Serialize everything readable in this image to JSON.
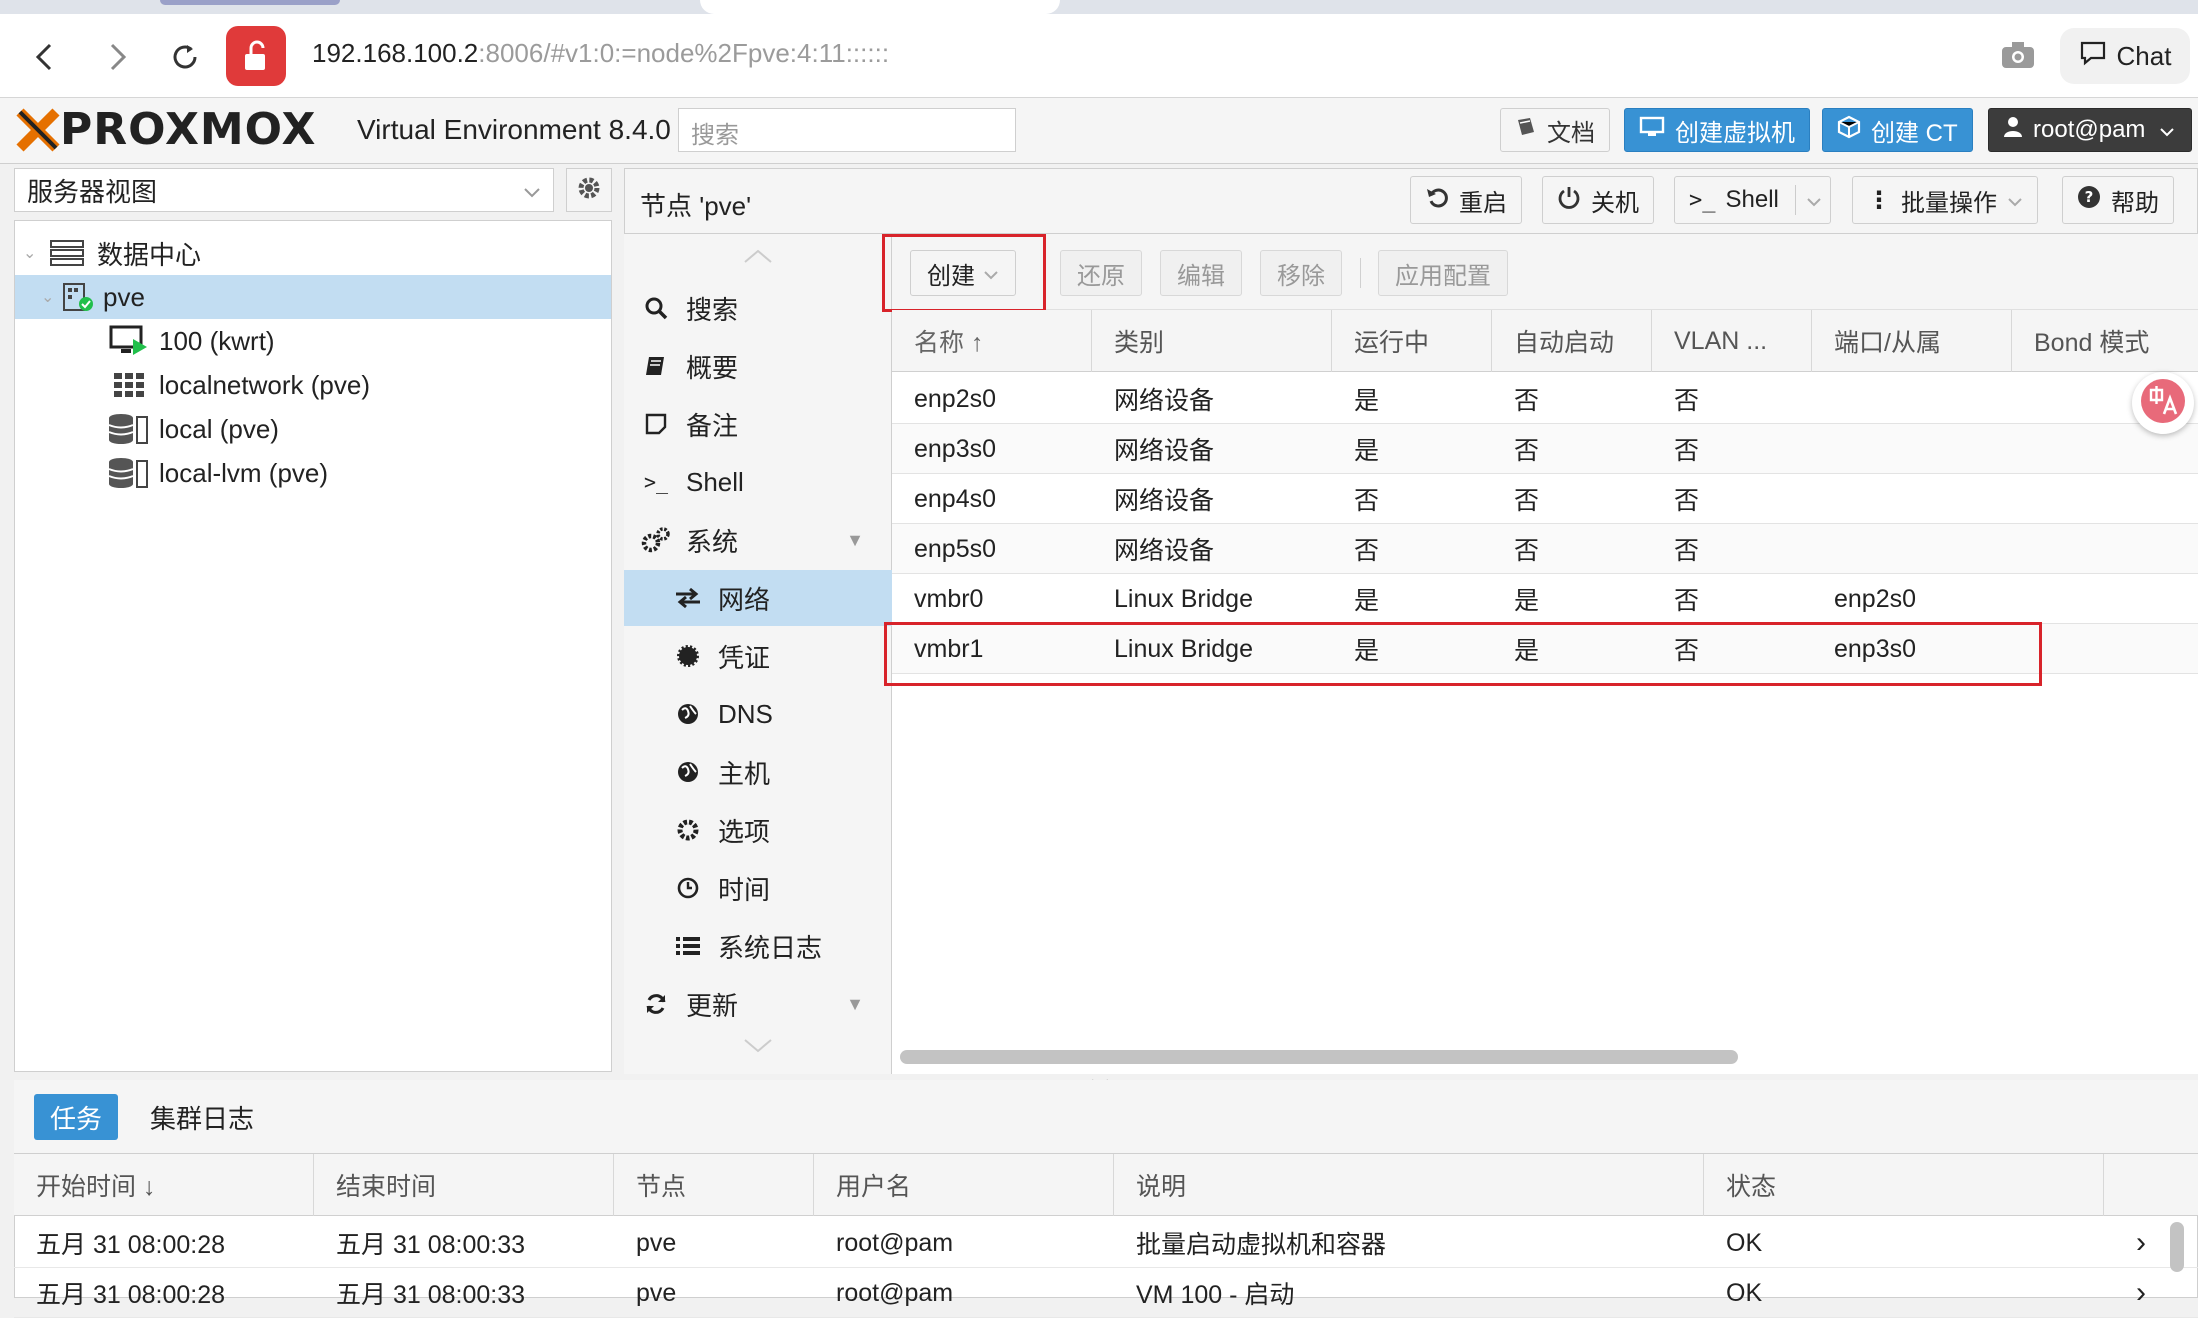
{
  "browser": {
    "url_host": "192.168.100.2",
    "url_rest": ":8006/#v1:0:=node%2Fpve:4:11::::::",
    "chat_label": "Chat",
    "icons": [
      "back-icon",
      "forward-icon",
      "reload-icon",
      "unlock-icon",
      "camera-icon",
      "chat-icon"
    ]
  },
  "header": {
    "logo_text": "PROXMOX",
    "product": "Virtual Environment 8.4.0",
    "search_placeholder": "搜索",
    "docs_label": "文档",
    "create_vm_label": "创建虚拟机",
    "create_ct_label": "创建 CT",
    "user_label": "root@pam"
  },
  "tree": {
    "view_label": "服务器视图",
    "items": [
      {
        "label": "数据中心",
        "icon": "datacenter-icon"
      },
      {
        "label": "pve",
        "icon": "node-icon",
        "selected": true
      },
      {
        "label": "100 (kwrt)",
        "icon": "vm-running-icon"
      },
      {
        "label": "localnetwork (pve)",
        "icon": "sdn-grid-icon"
      },
      {
        "label": "local (pve)",
        "icon": "storage-icon"
      },
      {
        "label": "local-lvm (pve)",
        "icon": "storage-icon"
      }
    ]
  },
  "node": {
    "title": "节点 'pve'",
    "restart_label": "重启",
    "shutdown_label": "关机",
    "shell_label": "Shell",
    "bulk_label": "批量操作",
    "help_label": "帮助"
  },
  "menu": {
    "items": [
      {
        "label": "搜索",
        "icon": "search-icon"
      },
      {
        "label": "概要",
        "icon": "book-icon"
      },
      {
        "label": "备注",
        "icon": "note-icon"
      },
      {
        "label": "Shell",
        "icon": "terminal-icon"
      },
      {
        "label": "系统",
        "icon": "cogs-icon"
      },
      {
        "label": "网络",
        "icon": "exchange-icon",
        "selected": true
      },
      {
        "label": "凭证",
        "icon": "certificate-icon"
      },
      {
        "label": "DNS",
        "icon": "globe-icon"
      },
      {
        "label": "主机",
        "icon": "globe-icon"
      },
      {
        "label": "选项",
        "icon": "gear-icon"
      },
      {
        "label": "时间",
        "icon": "clock-icon"
      },
      {
        "label": "系统日志",
        "icon": "list-icon"
      },
      {
        "label": "更新",
        "icon": "refresh-icon"
      }
    ]
  },
  "network": {
    "toolbar": {
      "create": "创建",
      "revert": "还原",
      "edit": "编辑",
      "remove": "移除",
      "apply": "应用配置"
    },
    "columns": [
      "名称 ↑",
      "类别",
      "运行中",
      "自动启动",
      "VLAN ...",
      "端口/从属",
      "Bond 模式"
    ],
    "rows": [
      [
        "enp2s0",
        "网络设备",
        "是",
        "否",
        "否",
        "",
        ""
      ],
      [
        "enp3s0",
        "网络设备",
        "是",
        "否",
        "否",
        "",
        ""
      ],
      [
        "enp4s0",
        "网络设备",
        "否",
        "否",
        "否",
        "",
        ""
      ],
      [
        "enp5s0",
        "网络设备",
        "否",
        "否",
        "否",
        "",
        ""
      ],
      [
        "vmbr0",
        "Linux Bridge",
        "是",
        "是",
        "否",
        "enp2s0",
        ""
      ],
      [
        "vmbr1",
        "Linux Bridge",
        "是",
        "是",
        "否",
        "enp3s0",
        ""
      ]
    ]
  },
  "tasks": {
    "tab_tasks": "任务",
    "tab_cluster_log": "集群日志",
    "columns": [
      "开始时间 ↓",
      "结束时间",
      "节点",
      "用户名",
      "说明",
      "状态"
    ],
    "rows": [
      [
        "五月 31 08:00:28",
        "五月 31 08:00:33",
        "pve",
        "root@pam",
        "批量启动虚拟机和容器",
        "OK"
      ],
      [
        "五月 31 08:00:28",
        "五月 31 08:00:33",
        "pve",
        "root@pam",
        "VM 100 - 启动",
        "OK"
      ]
    ]
  },
  "colors": {
    "accent_blue": "#3892d4",
    "selection": "#c2ddf2",
    "logo_orange": "#e57000",
    "annotation_red": "#d8232a"
  }
}
